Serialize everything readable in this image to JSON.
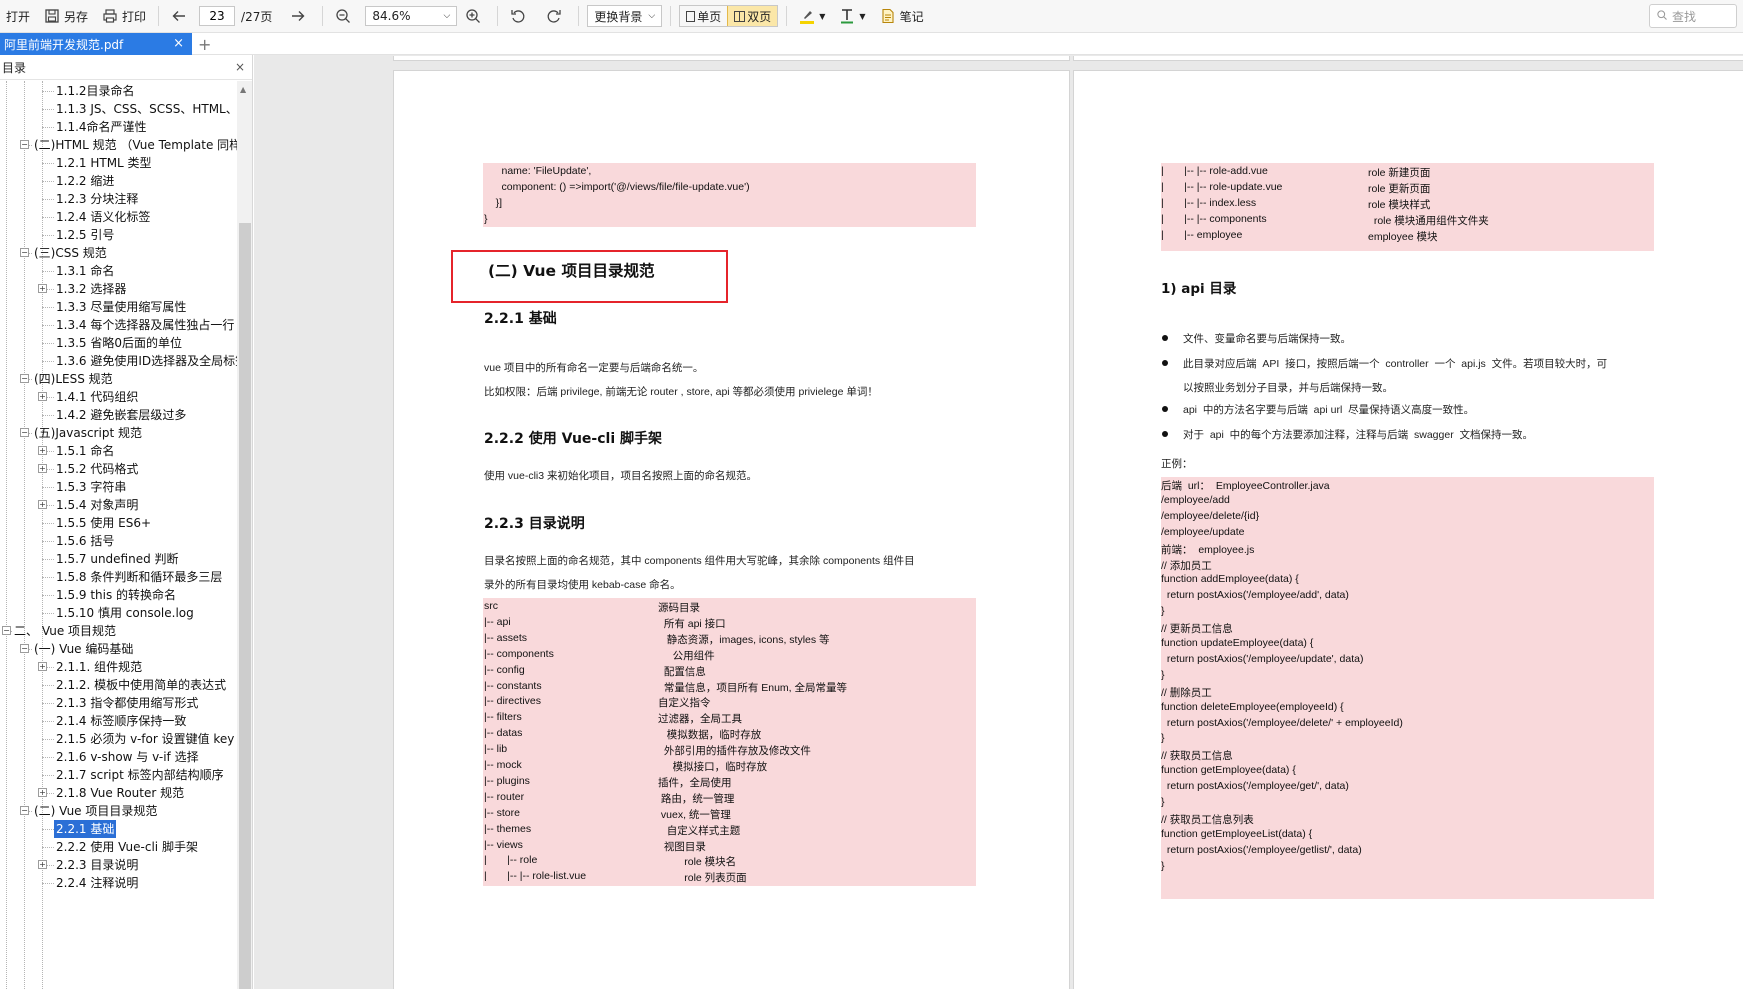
{
  "toolbar": {
    "open": "打开",
    "save_as": "另存",
    "print": "打印",
    "page_current": "23",
    "page_total": "/27页",
    "zoom": "84.6%",
    "background": "更换背景",
    "single_page": "单页",
    "double_page": "双页",
    "notes": "笔记",
    "search_placeholder": "查找"
  },
  "tab": {
    "title": "阿里前端开发规范.pdf",
    "close": "×",
    "new": "+"
  },
  "sidebar": {
    "title": "目录",
    "close": "×",
    "items": [
      {
        "text": "1.1.2目录命名",
        "level": 2,
        "exp": false
      },
      {
        "text": "1.1.3 JS、CSS、SCSS、HTML、PNG",
        "level": 2,
        "exp": false
      },
      {
        "text": "1.1.4命名严谨性",
        "level": 2,
        "exp": false
      },
      {
        "text": "(二)HTML 规范 （Vue Template 同样适用）",
        "level": 1,
        "exp": true
      },
      {
        "text": "1.2.1 HTML 类型",
        "level": 2,
        "exp": false
      },
      {
        "text": "1.2.2 缩进",
        "level": 2,
        "exp": false
      },
      {
        "text": "1.2.3 分块注释",
        "level": 2,
        "exp": false
      },
      {
        "text": "1.2.4 语义化标签",
        "level": 2,
        "exp": false
      },
      {
        "text": "1.2.5 引号",
        "level": 2,
        "exp": false
      },
      {
        "text": "(三)CSS 规范",
        "level": 1,
        "exp": true
      },
      {
        "text": "1.3.1 命名",
        "level": 2,
        "exp": false
      },
      {
        "text": "1.3.2 选择器",
        "level": 2,
        "exp": true
      },
      {
        "text": "1.3.3 尽量使用缩写属性",
        "level": 2,
        "exp": false
      },
      {
        "text": "1.3.4 每个选择器及属性独占一行",
        "level": 2,
        "exp": false
      },
      {
        "text": "1.3.5 省略0后面的单位",
        "level": 2,
        "exp": false
      },
      {
        "text": "1.3.6 避免使用ID选择器及全局标签选择器",
        "level": 2,
        "exp": false
      },
      {
        "text": "(四)LESS 规范",
        "level": 1,
        "exp": true
      },
      {
        "text": "1.4.1 代码组织",
        "level": 2,
        "exp": true
      },
      {
        "text": "1.4.2 避免嵌套层级过多",
        "level": 2,
        "exp": false
      },
      {
        "text": "(五)Javascript 规范",
        "level": 1,
        "exp": true
      },
      {
        "text": "1.5.1 命名",
        "level": 2,
        "exp": true
      },
      {
        "text": "1.5.2 代码格式",
        "level": 2,
        "exp": true
      },
      {
        "text": "1.5.3 字符串",
        "level": 2,
        "exp": false
      },
      {
        "text": "1.5.4 对象声明",
        "level": 2,
        "exp": true
      },
      {
        "text": "1.5.5 使用 ES6+",
        "level": 2,
        "exp": false
      },
      {
        "text": "1.5.6 括号",
        "level": 2,
        "exp": false
      },
      {
        "text": "1.5.7 undefined 判断",
        "level": 2,
        "exp": false
      },
      {
        "text": "1.5.8 条件判断和循环最多三层",
        "level": 2,
        "exp": false
      },
      {
        "text": "1.5.9  this 的转换命名",
        "level": 2,
        "exp": false
      },
      {
        "text": "1.5.10 慎用 console.log",
        "level": 2,
        "exp": false
      },
      {
        "text": "二、 Vue 项目规范",
        "level": 0,
        "exp": true
      },
      {
        "text": "(一) Vue 编码基础",
        "level": 1,
        "exp": true
      },
      {
        "text": "2.1.1. 组件规范",
        "level": 2,
        "exp": true
      },
      {
        "text": "2.1.2. 模板中使用简单的表达式",
        "level": 2,
        "exp": false
      },
      {
        "text": "2.1.3 指令都使用缩写形式",
        "level": 2,
        "exp": false
      },
      {
        "text": "2.1.4 标签顺序保持一致",
        "level": 2,
        "exp": false
      },
      {
        "text": "2.1.5 必须为 v-for 设置键值 key",
        "level": 2,
        "exp": false
      },
      {
        "text": "2.1.6 v-show 与 v-if 选择",
        "level": 2,
        "exp": false
      },
      {
        "text": "2.1.7 script 标签内部结构顺序",
        "level": 2,
        "exp": false
      },
      {
        "text": "2.1.8 Vue Router 规范",
        "level": 2,
        "exp": true
      },
      {
        "text": "(二) Vue 项目目录规范",
        "level": 1,
        "exp": true
      },
      {
        "text": "2.2.1 基础",
        "level": 2,
        "exp": false,
        "selected": true
      },
      {
        "text": "2.2.2 使用 Vue-cli 脚手架",
        "level": 2,
        "exp": false
      },
      {
        "text": "2.2.3 目录说明",
        "level": 2,
        "exp": true
      },
      {
        "text": "2.2.4 注释说明",
        "level": 2,
        "exp": false
      }
    ]
  },
  "page_left": {
    "code_top": [
      "      name: 'FileUpdate',",
      "      component: () =>import('@/views/file/file-update.vue')",
      "    }]",
      "}"
    ],
    "section_title": "(二) Vue  项目目录规范",
    "h_basic": "2.2.1  基础",
    "p_basic_1": "vue  项目中的所有命名一定要与后端命名统一。",
    "p_basic_2": "比如权限：后端  privilege,  前端无论  router , store, api  等都必须使用  privielege  单词！",
    "h_cli": "2.2.2  使用  Vue-cli  脚手架",
    "p_cli": "使用  vue-cli3  来初始化项目，项目名按照上面的命名规范。",
    "h_dir": "2.2.3  目录说明",
    "p_dir_1": "目录名按照上面的命名规范，其中  components  组件用大写驼峰，其余除  components  组件目",
    "p_dir_2": "录外的所有目录均使用  kebab-case  命名。",
    "dir_rows": [
      {
        "path": "src",
        "desc": "源码目录"
      },
      {
        "path": "|-- api",
        "desc": "  所有 api 接口"
      },
      {
        "path": "|-- assets",
        "desc": "   静态资源，images, icons, styles 等"
      },
      {
        "path": "|-- components",
        "desc": "     公用组件"
      },
      {
        "path": "|-- config",
        "desc": "  配置信息"
      },
      {
        "path": "|-- constants",
        "desc": "  常量信息，项目所有 Enum, 全局常量等"
      },
      {
        "path": "|-- directives",
        "desc": "自定义指令"
      },
      {
        "path": "|-- filters",
        "desc": "过滤器，全局工具"
      },
      {
        "path": "|-- datas",
        "desc": "   模拟数据，临时存放"
      },
      {
        "path": "|-- lib",
        "desc": "  外部引用的插件存放及修改文件"
      },
      {
        "path": "|-- mock",
        "desc": "     模拟接口，临时存放"
      },
      {
        "path": "|-- plugins",
        "desc": "插件，全局使用"
      },
      {
        "path": "|-- router",
        "desc": " 路由，统一管理"
      },
      {
        "path": "|-- store",
        "desc": " vuex, 统一管理"
      },
      {
        "path": "|-- themes",
        "desc": "   自定义样式主题"
      },
      {
        "path": "|-- views",
        "desc": "  视图目录"
      },
      {
        "path": "|       |-- role",
        "desc": "         role 模块名"
      },
      {
        "path": "|       |-- |-- role-list.vue",
        "desc": "         role 列表页面"
      }
    ]
  },
  "page_right": {
    "dir_rows": [
      {
        "path": "|       |-- |-- role-add.vue",
        "desc": "role 新建页面"
      },
      {
        "path": "|       |-- |-- role-update.vue",
        "desc": "role 更新页面"
      },
      {
        "path": "|       |-- |-- index.less",
        "desc": "role 模块样式"
      },
      {
        "path": "|       |-- |-- components",
        "desc": "  role 模块通用组件文件夹"
      },
      {
        "path": "|       |-- employee",
        "desc": "employee 模块"
      }
    ],
    "h_api": "1) api  目录",
    "bullets": [
      [
        "文件、变量命名要与后端保持一致。"
      ],
      [
        "此目录对应后端  API  接口，按照后端一个  controller  一个  api.js  文件。若项目较大时，可",
        "以按照业务划分子目录，并与后端保持一致。"
      ],
      [
        "api  中的方法名字要与后端  api url  尽量保持语义高度一致性。"
      ],
      [
        "对于  api  中的每个方法要添加注释，注释与后端  swagger  文档保持一致。"
      ]
    ],
    "example_label": "正例：",
    "code": [
      "后端  url：  EmployeeController.java",
      "/employee/add",
      "/employee/delete/{id}",
      "/employee/update",
      "前端：  employee.js",
      "// 添加员工",
      "function addEmployee(data) {",
      "  return postAxios('/employee/add', data)",
      "}",
      "// 更新员工信息",
      "function updateEmployee(data) {",
      "  return postAxios('/employee/update', data)",
      "}",
      "// 删除员工",
      "function deleteEmployee(employeeId) {",
      "  return postAxios('/employee/delete/' + employeeId)",
      "}",
      "// 获取员工信息",
      "function getEmployee(data) {",
      "  return postAxios('/employee/get/', data)",
      "}",
      "// 获取员工信息列表",
      "function getEmployeeList(data) {",
      "  return postAxios('/employee/getlist/', data)",
      "}"
    ]
  },
  "colors": {
    "accent": "#2b7be4",
    "highlight": "#e5242b",
    "code_bg": "#f9d9db"
  }
}
